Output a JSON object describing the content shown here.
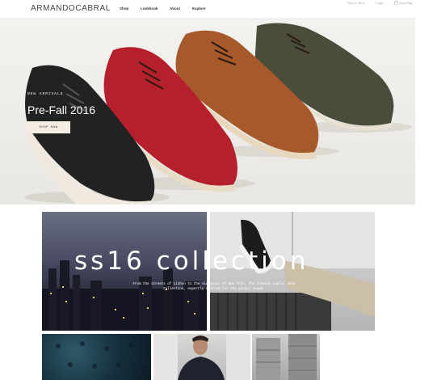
{
  "header": {
    "logo": "ARMANDOCABRAL",
    "nav": [
      {
        "label": "Shop"
      },
      {
        "label": "Lookbook"
      },
      {
        "label": "About"
      },
      {
        "label": "Explore"
      }
    ],
    "utility": [
      {
        "label": "Find a Store"
      },
      {
        "label": "Login"
      },
      {
        "label": "Your Bag"
      }
    ]
  },
  "hero": {
    "kicker": "NEW ARRIVALS",
    "title": "Pre-Fall 2016",
    "button": "SHOP NOW"
  },
  "collection": {
    "title": "ss16 collection",
    "description": "From the streets of Lisbon to the sidewalks of New York, the Armando Cabral SS16 Collection, expertly crafted for the global nomad."
  }
}
